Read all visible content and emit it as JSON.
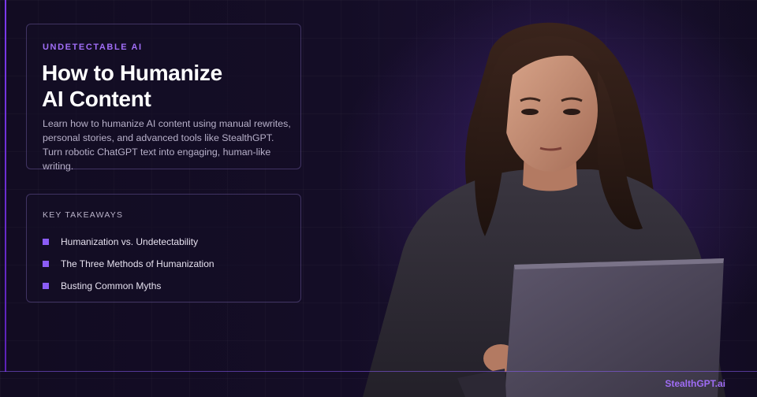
{
  "banner": {
    "eyebrow": "UNDETECTABLE AI",
    "title_line1": "How to Humanize",
    "title_line2": "AI Content",
    "description": "Learn how to humanize AI content using manual rewrites, personal stories, and advanced tools like StealthGPT. Turn robotic ChatGPT text into engaging, human-like writing."
  },
  "takeaways": {
    "heading": "KEY TAKEAWAYS",
    "items": [
      {
        "label": "Humanization vs. Undetectability"
      },
      {
        "label": "The Three Methods of Humanization"
      },
      {
        "label": "Busting Common Myths"
      }
    ]
  },
  "brand": "StealthGPT.ai",
  "colors": {
    "accent": "#8b5cf6",
    "eyebrow": "#a16ef7",
    "background": "#120c22",
    "border": "#6e5aa8"
  },
  "photo": {
    "subject": "woman-working-on-laptop"
  }
}
